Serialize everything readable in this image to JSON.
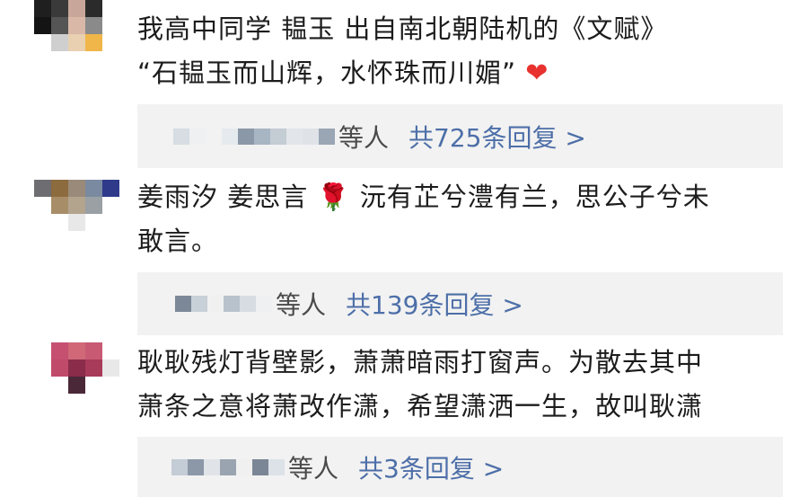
{
  "comments": [
    {
      "line1": "我高中同学  韫玉   出自南北朝陆机的《文赋》",
      "line2": "“石韫玉而山辉，水怀珠而川媚”",
      "heart": "❤",
      "suffix": "等人",
      "reply_link": "共725条回复 >"
    },
    {
      "line1": "姜雨汐 姜思言 🌹 沅有芷兮澧有兰，思公子兮未",
      "line2": "敢言。",
      "suffix": "等人",
      "reply_link": "共139条回复 >"
    },
    {
      "line1": "耿耿残灯背壁影，萧萧暗雨打窗声。为散去其中",
      "line2": "萧条之意将萧改作潇，希望潇洒一生，故叫耿潇",
      "suffix": "等人",
      "reply_link": "共3条回复 >"
    }
  ]
}
